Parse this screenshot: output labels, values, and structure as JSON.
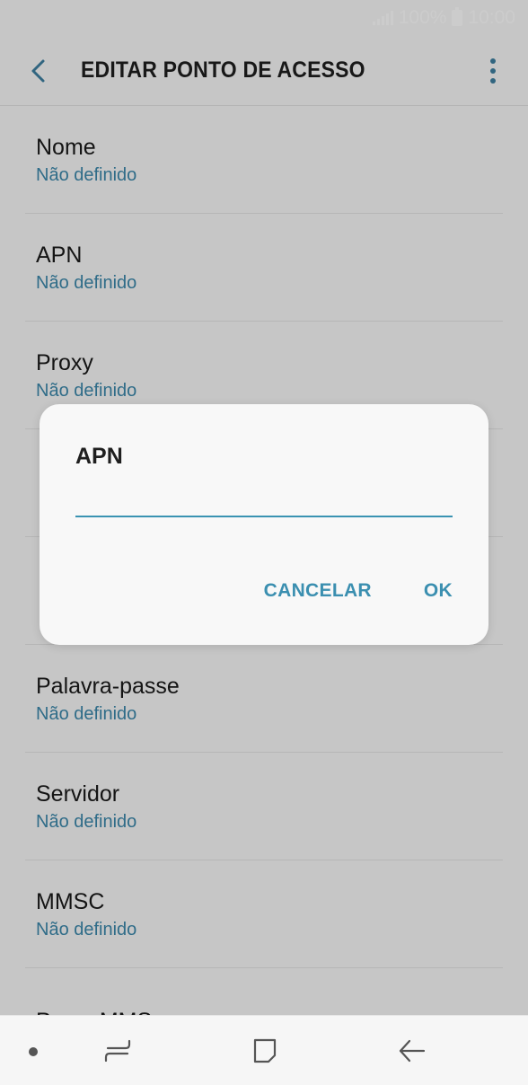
{
  "status_bar": {
    "battery": "100%",
    "time": "10:00"
  },
  "app_bar": {
    "title": "EDITAR PONTO DE ACESSO"
  },
  "list": {
    "items": [
      {
        "title": "Nome",
        "value": "Não definido"
      },
      {
        "title": "APN",
        "value": "Não definido"
      },
      {
        "title": "Proxy",
        "value": "Não definido"
      },
      {
        "title": "",
        "value": ""
      },
      {
        "title": "",
        "value": ""
      },
      {
        "title": "Palavra-passe",
        "value": "Não definido"
      },
      {
        "title": "Servidor",
        "value": "Não definido"
      },
      {
        "title": "MMSC",
        "value": "Não definido"
      },
      {
        "title": "Proxy MMS",
        "value": ""
      }
    ]
  },
  "dialog": {
    "title": "APN",
    "input_value": "",
    "cancel_label": "CANCELAR",
    "ok_label": "OK"
  },
  "colors": {
    "accent": "#3b8fb0",
    "value_text": "#3b87ab",
    "menu_dots": "#3e7fa0"
  },
  "icons": {
    "back": "back-arrow-icon",
    "menu": "more-vertical-icon",
    "nav_recent": "recent-apps-icon",
    "nav_home": "home-icon",
    "nav_back": "nav-back-icon"
  }
}
